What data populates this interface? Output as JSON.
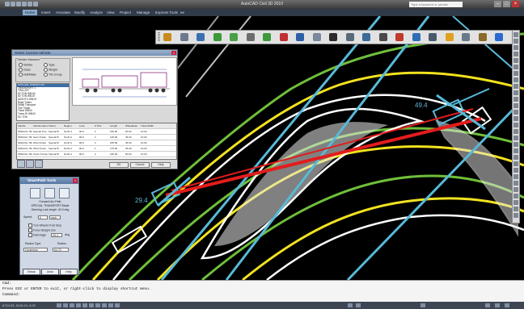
{
  "app": {
    "title": "AutoCAD Civil 3D 2010",
    "search_placeholder": "Type a keyword or phrase",
    "window_buttons": [
      "–",
      "□",
      "×"
    ]
  },
  "ribbon_tabs": [
    "Home",
    "Insert",
    "Annotate",
    "Modify",
    "Analyze",
    "View",
    "Project",
    "Manage",
    "Express Tools",
    "ee"
  ],
  "toolbar_icons": [
    "pencil-icon",
    "vehicle-icon",
    "car-icon",
    "path-icon",
    "swept-icon",
    "wheel-icon",
    "arc-icon",
    "spline-icon",
    "x-icon",
    "select-icon",
    "pointer-icon",
    "eraser-icon",
    "grid-icon",
    "table-icon",
    "tractor-icon",
    "report-icon",
    "copy-icon",
    "lightbulb-icon",
    "refresh-icon",
    "export-icon",
    "info-icon"
  ],
  "dimensions": {
    "right_label": "49.4",
    "left_label": "29.4"
  },
  "vehicle_dialog": {
    "title": "Select Current Vehicle",
    "close": "×",
    "group_label": "Vehicle Selection",
    "radios": [
      "Vehicle",
      "Type",
      "Class",
      "Weight",
      "Hull/Make",
      "Tire Group"
    ],
    "list_items": [
      "SPECIAL TRANSPORT",
      "TRANSPORT 1",
      "TRA-LER",
      "60 TON WB-62",
      "60 TON WB-67",
      "AASHTO WB-67",
      "Rigid Trailer",
      "Small Transport",
      "Tow Trailer",
      "Trans WB30",
      "Trans-Ri WB40",
      "SU TON"
    ],
    "grid_headers": [
      "Vehicle",
      "Vehicle Name",
      "Owner",
      "Region",
      "Lock",
      "# Trlrs",
      "Length",
      "Wheelbase",
      "Track Width"
    ],
    "grid_rows": [
      [
        "SPECIAL TRA",
        "Special Tran",
        "Special B",
        "North A",
        "90.0",
        "2",
        "165.00",
        "50.00",
        "10.00"
      ],
      [
        "SPECIAL TRA",
        "Semi-Trailer",
        "Special B",
        "North A",
        "90.0",
        "2",
        "145.00",
        "45.00",
        "10.00"
      ],
      [
        "SPECIAL TRA",
        "Wind Power",
        "Special B",
        "North A",
        "90.0",
        "1",
        "185.00",
        "45.00",
        "10.00"
      ],
      [
        "SPECIAL TRA",
        "Wind Power",
        "Special B",
        "North A",
        "90.0",
        "1",
        "175.00",
        "45.00",
        "10.00"
      ],
      [
        "SPECIAL TRA",
        "Tower Transp",
        "Special B",
        "North A",
        "90.0",
        "2",
        "160.00",
        "50.00",
        "10.00"
      ],
      [
        "SPECIAL TRA",
        "Blade Transp",
        "Special B",
        "North A",
        "90.0",
        "1",
        "180.00",
        "45.00",
        "10.00"
      ]
    ],
    "buttons": [
      "OK",
      "Cancel",
      "Help"
    ]
  },
  "smartpath": {
    "title": "SmartPath Tools",
    "close": "×",
    "mode": "Forward Arc Path",
    "vehicle": "SPECIAL TRANSPORT Blade",
    "steering": "Steering Lock Angle: 40.5 deg",
    "speed_label": "Speed:",
    "speed_value": "0",
    "speed_unit": "mph",
    "check_turn": "Turn Wheels Front Stop",
    "check_force": "Force Straight Line",
    "path_angle_label": "Path Angle",
    "path_angle_value": "29.4",
    "path_angle_unit": "deg",
    "radius_type_label": "Radius Type",
    "radius_label": "Radius",
    "radius_type_value": "Centerline",
    "radius_value": "64.70",
    "buttons": [
      "Break",
      "Undo",
      "Help"
    ]
  },
  "command_line": [
    "Cmd:",
    "Press ESC or ENTER to exit, or right-click to display shortcut menu.",
    "Command:"
  ],
  "status": {
    "coords": "6724.53, 5115.24, 0.00"
  }
}
